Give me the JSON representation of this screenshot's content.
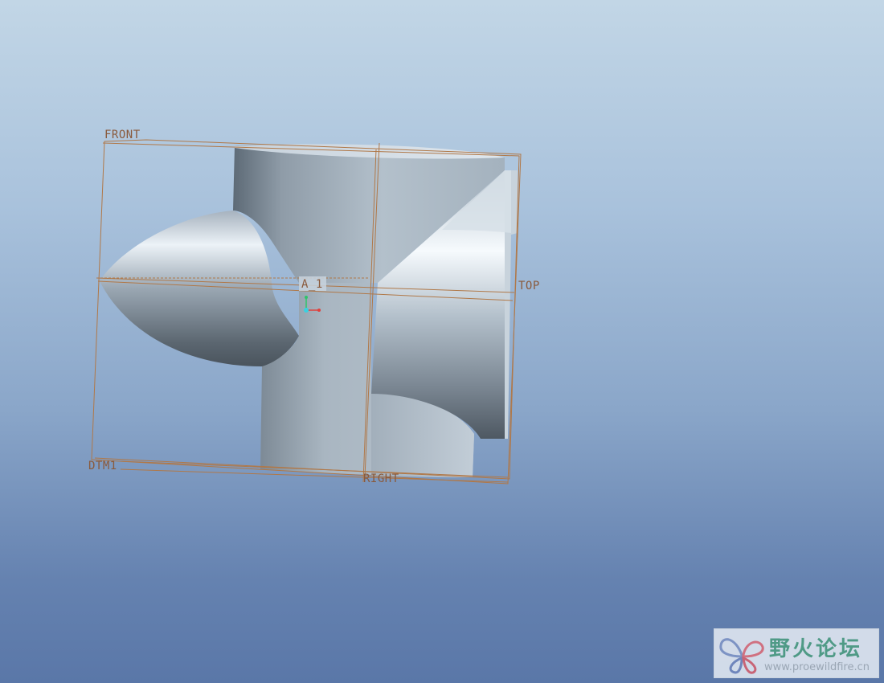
{
  "datums": {
    "front": "FRONT",
    "top": "TOP",
    "right": "RIGHT",
    "dtm1": "DTM1",
    "axis": "A_1"
  },
  "watermark": {
    "title": "野火论坛",
    "url": "www.proewildfire.cn",
    "logo_icon": "butterfly-icon"
  },
  "colors": {
    "background_top": "#c2d6e6",
    "background_bottom": "#5a77a8",
    "datum_line": "#b07848",
    "model_surface": "#a9b6c1",
    "watermark_text": "#4f9a86"
  }
}
